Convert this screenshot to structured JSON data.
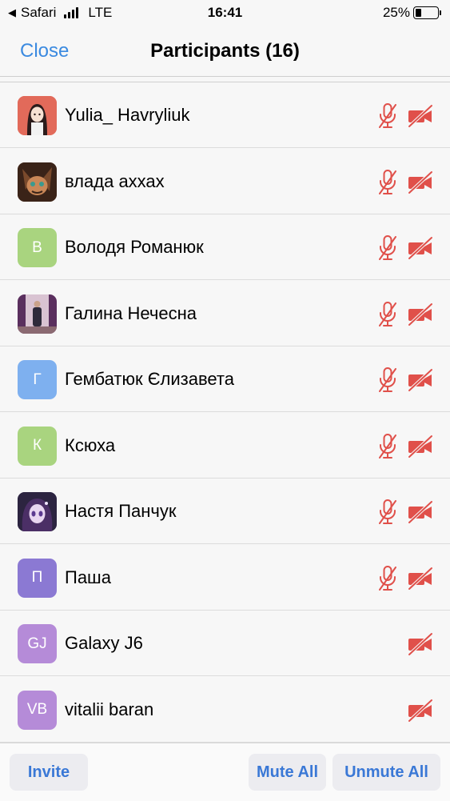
{
  "status_bar": {
    "back_app": "Safari",
    "carrier": "LTE",
    "time": "16:41",
    "battery_text": "25%",
    "battery_level": 0.25
  },
  "header": {
    "close_label": "Close",
    "title": "Participants (16)"
  },
  "participants": [
    {
      "name": "Yulia_ Havryliuk",
      "avatar_type": "photo",
      "avatar_color": "#d9685a",
      "mic_muted": true,
      "cam_off": true
    },
    {
      "name": "влада аххах",
      "avatar_type": "photo",
      "avatar_color": "#6b3a22",
      "mic_muted": true,
      "cam_off": true
    },
    {
      "name": "Володя Романюк",
      "avatar_initials": "В",
      "avatar_color": "#a9d47f",
      "mic_muted": true,
      "cam_off": true
    },
    {
      "name": "Галина Нечесна",
      "avatar_type": "photo",
      "avatar_color": "#b48aa3",
      "mic_muted": true,
      "cam_off": true
    },
    {
      "name": "Гембатюк Єлизавета",
      "avatar_initials": "Г",
      "avatar_color": "#7eb0ef",
      "mic_muted": true,
      "cam_off": true
    },
    {
      "name": "Ксюха",
      "avatar_initials": "К",
      "avatar_color": "#a9d47f",
      "mic_muted": true,
      "cam_off": true
    },
    {
      "name": "Настя Панчук",
      "avatar_type": "photo",
      "avatar_color": "#3c3160",
      "mic_muted": true,
      "cam_off": true
    },
    {
      "name": "Паша",
      "avatar_initials": "П",
      "avatar_color": "#8b79d3",
      "mic_muted": true,
      "cam_off": true
    },
    {
      "name": "Galaxy J6",
      "avatar_initials": "GJ",
      "avatar_color": "#b58bd8",
      "mic_muted": false,
      "cam_off": true
    },
    {
      "name": "vitalii baran",
      "avatar_initials": "VB",
      "avatar_color": "#b58bd8",
      "mic_muted": false,
      "cam_off": true
    }
  ],
  "bottom_bar": {
    "invite_label": "Invite",
    "mute_all_label": "Mute All",
    "unmute_all_label": "Unmute All"
  },
  "colors": {
    "accent": "#3b8ae0",
    "muted_red": "#e0504a"
  }
}
